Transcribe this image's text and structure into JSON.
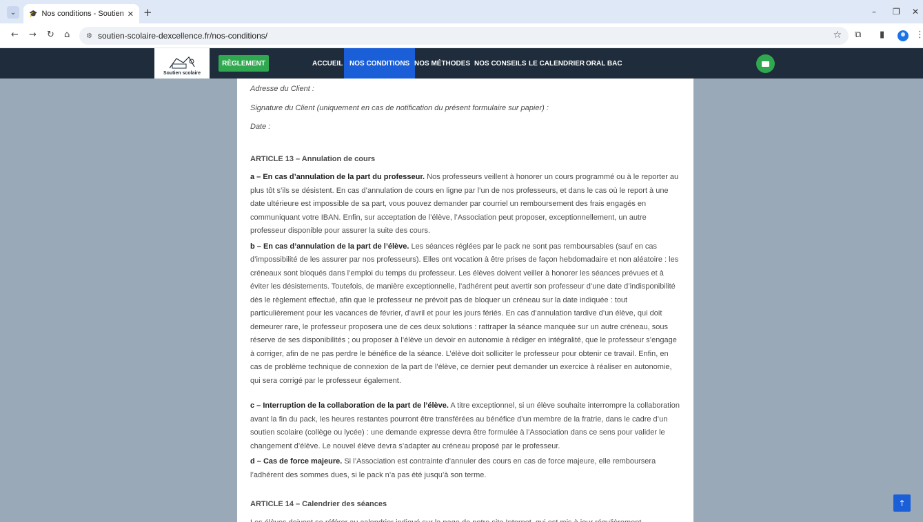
{
  "browser": {
    "tab_title": "Nos conditions - Soutien scolai",
    "tab_close": "✕",
    "new_tab": "+",
    "url": "soutien-scolaire-dexcellence.fr/nos-conditions/",
    "back": "←",
    "forward": "→",
    "reload": "↻",
    "home": "⌂",
    "minimize": "–",
    "restore": "❐",
    "close": "✕",
    "star": "☆",
    "menu": "⋮"
  },
  "site": {
    "logo_text": "Soutien scolaire",
    "reglement_button": "RÈGLEMENT",
    "nav": [
      {
        "label": "ACCUEIL"
      },
      {
        "label": "NOS CONDITIONS"
      },
      {
        "label": "NOS MÉTHODES"
      },
      {
        "label": "NOS CONSEILS"
      },
      {
        "label": "LE CALENDRIER"
      },
      {
        "label": "ORAL BAC"
      }
    ],
    "accent_color": "#1a5fd8",
    "button_color": "#2fa84f"
  },
  "content": {
    "form_lines": [
      "Adresse du Client :",
      "Signature du Client (uniquement en cas de notification du présent formulaire sur papier) :",
      "Date :"
    ],
    "article13": {
      "title": "ARTICLE 13 – Annulation de cours",
      "a_lead": "a – En cas d’annulation de la part du professeur.",
      "a_text": " Nos professeurs veillent à honorer un cours programmé ou à le reporter au plus tôt s’ils se désistent. En cas d’annulation de cours en ligne par l’un de nos professeurs, et dans le cas où le report à une date ultérieure est impossible de sa part, vous pouvez demander par courriel un remboursement des frais engagés en communiquant votre IBAN. Enfin, sur acceptation de l’élève, l’Association peut proposer, exceptionnellement, un autre professeur disponible pour assurer la suite des cours.",
      "b_lead": "b – En cas d’annulation de la part de l’élève.",
      "b_text": " Les séances réglées par le pack ne sont pas remboursables (sauf en cas d’impossibilité de les assurer par nos professeurs). Elles ont vocation à être prises de façon hebdomadaire et non aléatoire : les créneaux sont bloqués dans l’emploi du temps du professeur. Les élèves doivent veiller à honorer les séances prévues et à éviter les désistements. Toutefois, de manière exceptionnelle, l’adhérent peut avertir son professeur d’une date d’indisponibilité dès le règlement effectué, afin que le professeur ne prévoit pas de bloquer un créneau sur la date indiquée : tout particulièrement pour les vacances de février, d’avril et pour les jours fériés. En cas d’annulation tardive d’un élève, qui doit demeurer rare, le professeur proposera une de ces deux solutions : rattraper la séance manquée sur un autre créneau, sous réserve de ses disponibilités ; ou proposer à l’élève un devoir en autonomie à rédiger en intégralité, que le professeur s’engage à corriger, afin de ne pas perdre le bénéfice de la séance. L’élève doit solliciter le professeur pour obtenir ce travail. Enfin, en cas de problème technique de connexion de la part de l’élève, ce dernier peut demander un exercice à réaliser en autonomie, qui sera corrigé par le professeur également.",
      "c_lead": "c – Interruption de la collaboration de la part de l’élève.",
      "c_text": " A titre exceptionnel, si un élève souhaite interrompre la collaboration avant la fin du pack, les heures restantes pourront être transférées au bénéfice d’un membre de la fratrie, dans le cadre d’un soutien scolaire (collège ou lycée) : une demande expresse devra être formulée à l’Association dans ce sens pour valider le changement d’élève. Le nouvel élève devra s’adapter au créneau proposé par le professeur.",
      "d_lead": "d – Cas de force majeure.",
      "d_text": " Si l’Association est contrainte d’annuler des cours en cas de force majeure, elle remboursera l’adhérent des sommes dues, si le pack n’a pas été jusqu’à son terme."
    },
    "article14": {
      "title": "ARTICLE 14 – Calendrier des séances",
      "text": "Les élèves doivent se référer au calendrier indiqué sur la page de notre site Internet, qui est mis à jour régulièrement."
    }
  },
  "scroll_top": "↑"
}
